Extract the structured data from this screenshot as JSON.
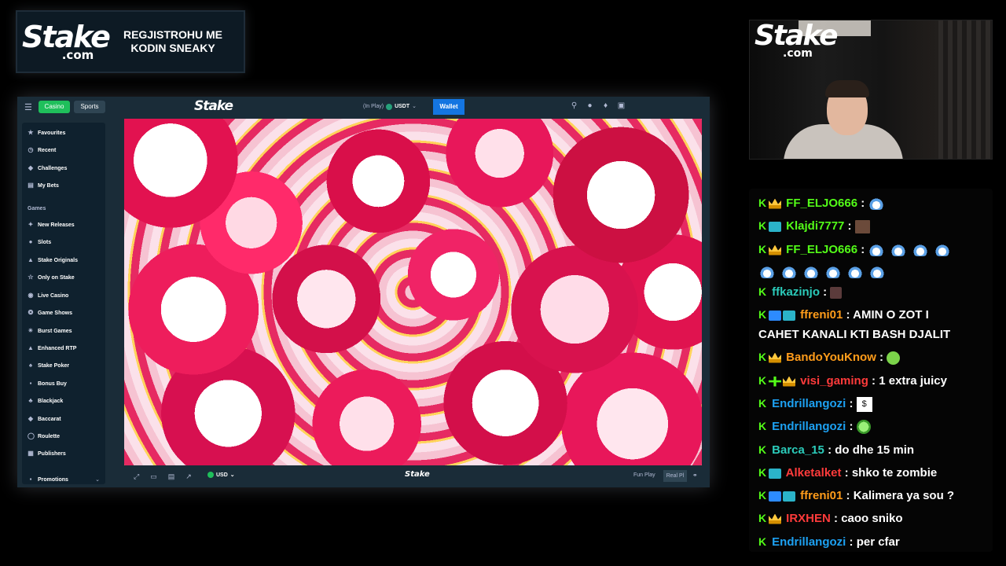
{
  "promo": {
    "logo_word": "Stake",
    "logo_com": ".com",
    "text": "REGJISTROHU ME KODIN SNEAKY"
  },
  "browser": {
    "top": {
      "casino_tab": "Casino",
      "sports_tab": "Sports",
      "logo": "Stake",
      "balance_label": "(In Play)",
      "balance_currency": "USDT",
      "wallet": "Wallet"
    },
    "sidebar": {
      "items_top": [
        "Favourites",
        "Recent",
        "Challenges",
        "My Bets"
      ],
      "games_heading": "Games",
      "games": [
        "New Releases",
        "Slots",
        "Stake Originals",
        "Only on Stake",
        "Live Casino",
        "Game Shows",
        "Burst Games",
        "Enhanced RTP",
        "Stake Poker",
        "Bonus Buy",
        "Blackjack",
        "Baccarat",
        "Roulette",
        "Publishers"
      ],
      "promotions": "Promotions"
    },
    "gamebar": {
      "currency": "USD",
      "logo": "Stake",
      "fun_play": "Fun Play",
      "real_play": "Real Pl"
    }
  },
  "webcam": {
    "logo_word": "Stake",
    "logo_com": ".com"
  },
  "chat": {
    "colors": {
      "kick_green": "#53fc18",
      "green": "#53fc18",
      "blue": "#1da1f2",
      "orange": "#ff9c1a",
      "red": "#ff3b3b",
      "teal": "#2bcbba"
    },
    "messages": [
      {
        "user": "FF_ELJO666",
        "text": ""
      },
      {
        "user": "Klajdi7777",
        "text": ""
      },
      {
        "user": "FF_ELJO666",
        "text": ""
      },
      {
        "user": "ffkazinjo",
        "text": ""
      },
      {
        "user": "ffreni01",
        "text": "AMIN O ZOT I",
        "text2": "CAHET KANALI KTI BASH DJALIT"
      },
      {
        "user": "BandoYouKnow",
        "text": ""
      },
      {
        "user": "visi_gaming",
        "text": "1 extra juicy"
      },
      {
        "user": "Endrillangozi",
        "text": ""
      },
      {
        "user": "Endrillangozi",
        "text": ""
      },
      {
        "user": "Barca_15",
        "text": "do dhe 15 min"
      },
      {
        "user": "Alketalket",
        "text": "shko te zombie"
      },
      {
        "user": "ffreni01",
        "text": "Kalimera ya sou ?"
      },
      {
        "user": "IRXHEN",
        "text": "caoo sniko"
      },
      {
        "user": "Endrillangozi",
        "text": "per cfar"
      }
    ]
  }
}
